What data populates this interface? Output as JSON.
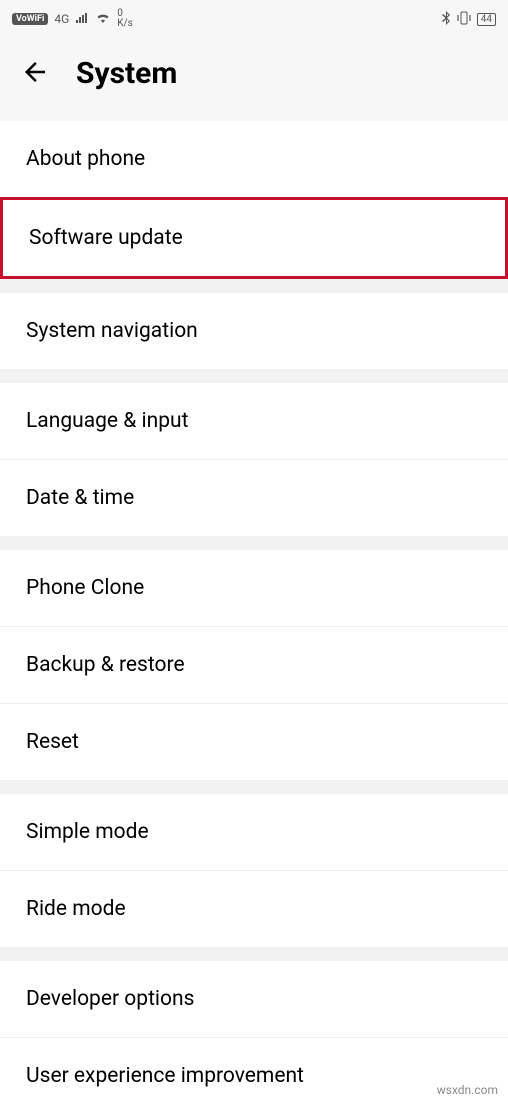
{
  "status_bar": {
    "vowifi": "VoWiFi",
    "network": "4G",
    "speed_value": "0",
    "speed_unit": "K/s",
    "battery": "44"
  },
  "header": {
    "title": "System"
  },
  "groups": [
    {
      "items": [
        {
          "label": "About phone",
          "key": "about-phone"
        }
      ]
    },
    {
      "highlight": true,
      "items": [
        {
          "label": "Software update",
          "key": "software-update"
        }
      ]
    },
    {
      "items": [
        {
          "label": "System navigation",
          "key": "system-navigation"
        }
      ]
    },
    {
      "items": [
        {
          "label": "Language & input",
          "key": "language-input"
        },
        {
          "label": "Date & time",
          "key": "date-time"
        }
      ]
    },
    {
      "items": [
        {
          "label": "Phone Clone",
          "key": "phone-clone"
        },
        {
          "label": "Backup & restore",
          "key": "backup-restore"
        },
        {
          "label": "Reset",
          "key": "reset"
        }
      ]
    },
    {
      "items": [
        {
          "label": "Simple mode",
          "key": "simple-mode"
        },
        {
          "label": "Ride mode",
          "key": "ride-mode"
        }
      ]
    },
    {
      "items": [
        {
          "label": "Developer options",
          "key": "developer-options"
        },
        {
          "label": "User experience improvement",
          "key": "user-experience-improvement"
        }
      ]
    }
  ],
  "watermark": "wsxdn.com"
}
